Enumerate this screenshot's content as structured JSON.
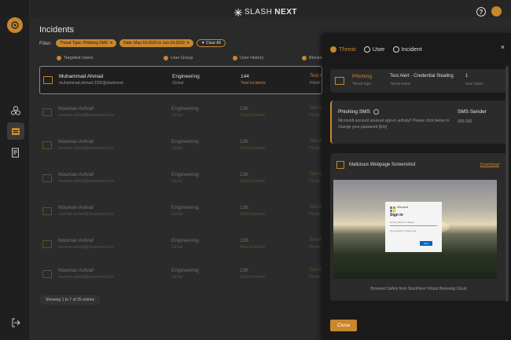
{
  "brand": {
    "name_prefix": "SLASH",
    "name_suffix": "NEXT",
    "icon": "burst-icon"
  },
  "page": {
    "title": "Incidents"
  },
  "filter": {
    "label": "Filter:",
    "chips": [
      {
        "label": "Threat Type: Phishing SMS"
      },
      {
        "label": "Date: May-19-2020 to Jun-19-2020"
      }
    ],
    "clear_label": "Clear All"
  },
  "columns": {
    "targeted_users": "Targeted Users",
    "user_group": "User Group",
    "user_history": "User History",
    "blocked": "Blocked"
  },
  "rows": [
    {
      "name": "Muhammad Ahmad",
      "email": "muhammad.ahmad.2392@slashnext",
      "group": "Engineering",
      "group_sub": "Global",
      "count": "144",
      "count_label": "Total Incidents",
      "block": "Test A",
      "block_sub": "Phishi"
    },
    {
      "name": "Nouman Ashraf",
      "email": "nouman.ashraf@slashnext.com",
      "group": "Engineering",
      "group_sub": "Global",
      "count": "136",
      "count_label": "Total Incidents",
      "block": "Test A",
      "block_sub": "Phishi"
    },
    {
      "name": "Nouman Ashraf",
      "email": "nouman.ashraf@slashnext.com",
      "group": "Engineering",
      "group_sub": "Global",
      "count": "136",
      "count_label": "Total Incidents",
      "block": "Test A",
      "block_sub": "Phishi"
    },
    {
      "name": "Nouman Ashraf",
      "email": "nouman.ashraf@slashnext.com",
      "group": "Engineering",
      "group_sub": "Global",
      "count": "136",
      "count_label": "Total Incidents",
      "block": "Test A",
      "block_sub": "Phishi"
    },
    {
      "name": "Nouman Ashraf",
      "email": "nouman.ashraf@slashnext.com",
      "group": "Engineering",
      "group_sub": "Global",
      "count": "136",
      "count_label": "Total Incidents",
      "block": "Test A",
      "block_sub": "Phishi"
    },
    {
      "name": "Nouman Ashraf",
      "email": "nouman.ashraf@slashnext.com",
      "group": "Engineering",
      "group_sub": "Global",
      "count": "136",
      "count_label": "Total Incidents",
      "block": "Test A",
      "block_sub": "Phishi"
    },
    {
      "name": "Nouman Ashraf",
      "email": "nouman.ashraf@slashnext.com",
      "group": "Engineering",
      "group_sub": "Global",
      "count": "136",
      "count_label": "Total Incidents",
      "block": "Test A",
      "block_sub": "Phishi"
    }
  ],
  "pager": {
    "text": "Showing 1 to 7 of 25 entries"
  },
  "panel": {
    "tabs": [
      {
        "label": "Threat",
        "icon": "threat-icon"
      },
      {
        "label": "User",
        "icon": "user-icon"
      },
      {
        "label": "Incident",
        "icon": "incident-icon"
      }
    ],
    "close_glyph": "×",
    "summary": {
      "threat": "Phishing",
      "threat_label": "Threat Type",
      "name": "Test Alert - Credential Stealing",
      "name_label": "Threat Name",
      "count": "1",
      "count_label": "User Clicks"
    },
    "sms": {
      "title": "Phishing SMS",
      "message": "Microsoft account unusual sign-in activity!! Please click below to change your password [link]",
      "sender_label": "SMS Sender",
      "sender_number": "000-000"
    },
    "screenshot": {
      "title": "Malicious Webpage Screenshot",
      "download_label": "Download",
      "login_brand": "Microsoft",
      "login_title": "Sign in",
      "login_field1": "Email, phone, or Skype",
      "login_field2": "No account? Create one!",
      "login_button": "Next",
      "caption": "Browsed Safely from SlashNext Virtual Browsing Cloud"
    },
    "close_button": "Close"
  },
  "colors": {
    "accent": "#c8862d",
    "background": "#262626",
    "panel": "#1a1a1a"
  }
}
